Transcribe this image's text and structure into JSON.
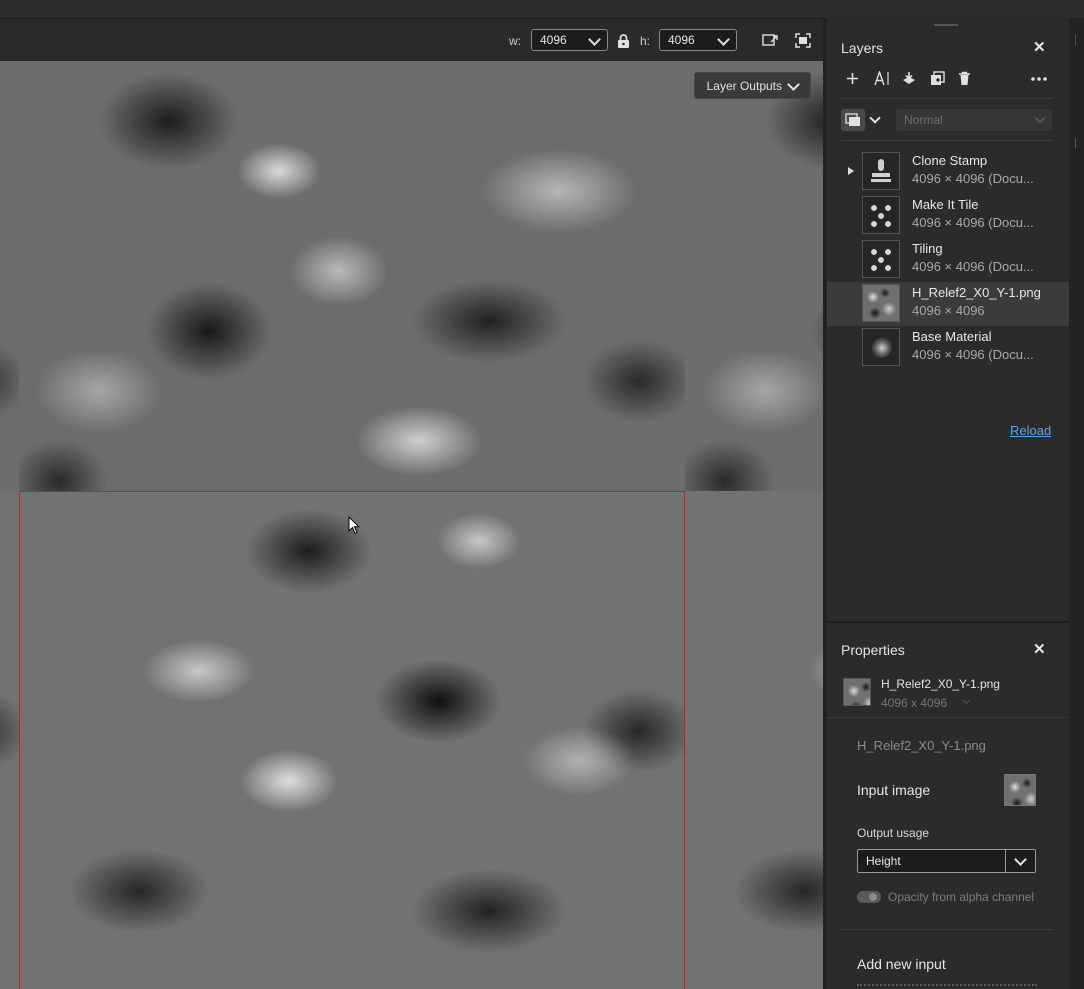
{
  "toolbar": {
    "width_label": "w:",
    "width_value": "4096",
    "height_label": "h:",
    "height_value": "4096",
    "lock_icon": "lock-icon",
    "view_icons": [
      "window-expand-icon",
      "fit-screen-icon"
    ]
  },
  "canvas": {
    "layer_outputs_label": "Layer Outputs",
    "selection_color": "#d11c1c"
  },
  "layers_panel": {
    "title": "Layers",
    "tools": [
      "add-icon",
      "text-layer-icon",
      "merge-down-icon",
      "duplicate-icon",
      "trash-icon",
      "more-icon"
    ],
    "blend_mode": "Normal",
    "layers": [
      {
        "name": "Clone Stamp",
        "subtitle": "4096 × 4096 (Docu...",
        "icon": "stamp-icon",
        "expandable": true
      },
      {
        "name": "Make It Tile",
        "subtitle": "4096 × 4096 (Docu...",
        "icon": "hex-grid-icon"
      },
      {
        "name": "Tiling",
        "subtitle": "4096 × 4096 (Docu...",
        "icon": "hex-grid-icon"
      },
      {
        "name": "H_Relef2_X0_Y-1.png",
        "subtitle": "4096 × 4096",
        "icon": "image-thumbnail",
        "selected": true
      },
      {
        "name": "Base Material",
        "subtitle": "4096 × 4096 (Docu...",
        "icon": "sphere-icon"
      }
    ],
    "reload_label": "Reload"
  },
  "properties_panel": {
    "title": "Properties",
    "item_name": "H_Relef2_X0_Y-1.png",
    "item_size": "4096 x 4096",
    "file_name": "H_Relef2_X0_Y-1.png",
    "input_image_label": "Input image",
    "output_usage_label": "Output usage",
    "output_usage_value": "Height",
    "opacity_label": "Opacity from alpha channel",
    "add_input_label": "Add new input"
  }
}
